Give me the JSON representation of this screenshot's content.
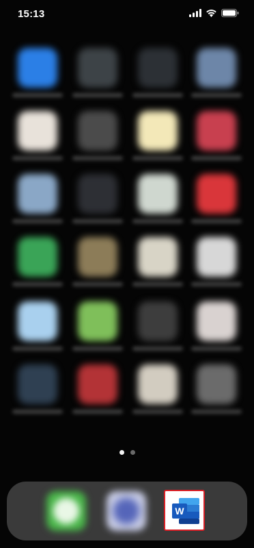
{
  "status_bar": {
    "time": "15:13",
    "signal_icon": "cellular-signal-icon",
    "wifi_icon": "wifi-icon",
    "battery_icon": "battery-icon"
  },
  "home_screen": {
    "apps": [
      {
        "name": "app-store-icon",
        "color": "#2b7fe6"
      },
      {
        "name": "blurred-app-icon",
        "color": "#3d4347"
      },
      {
        "name": "blurred-app-icon",
        "color": "#2c3035"
      },
      {
        "name": "blurred-app-icon",
        "color": "#6d86a8"
      },
      {
        "name": "google-photos-icon",
        "color": "#e8e2da"
      },
      {
        "name": "camera-icon",
        "color": "#4b4b4b"
      },
      {
        "name": "notes-icon",
        "color": "#f3e8b8"
      },
      {
        "name": "blurred-app-icon",
        "color": "#c8404f"
      },
      {
        "name": "blurred-app-icon",
        "color": "#8aa7c6"
      },
      {
        "name": "blurred-app-icon",
        "color": "#2d2f34"
      },
      {
        "name": "google-maps-icon",
        "color": "#cfd7cf"
      },
      {
        "name": "youtube-icon",
        "color": "#d9363a"
      },
      {
        "name": "google-sheets-icon",
        "color": "#3aa457"
      },
      {
        "name": "calculator-icon",
        "color": "#8c7c58"
      },
      {
        "name": "google-drive-icon",
        "color": "#d8d4c6"
      },
      {
        "name": "clock-icon",
        "color": "#d7d7d7"
      },
      {
        "name": "files-icon",
        "color": "#a9d0ee"
      },
      {
        "name": "messages-icon",
        "color": "#7fbf5a"
      },
      {
        "name": "blurred-app-icon",
        "color": "#3d3d3d"
      },
      {
        "name": "gmail-icon",
        "color": "#d9d2d0"
      },
      {
        "name": "wallpaper-icon",
        "color": "#2f4052"
      },
      {
        "name": "blurred-app-icon",
        "color": "#b33336"
      },
      {
        "name": "chrome-icon",
        "color": "#d2ccc0"
      },
      {
        "name": "blurred-app-icon",
        "color": "#6b6b6b"
      }
    ],
    "page_dots": {
      "count": 2,
      "active": 0
    }
  },
  "dock": {
    "apps": [
      {
        "name": "line-app-icon",
        "color": "#49b649"
      },
      {
        "name": "blurred-app-icon",
        "color": "#9aa3c9"
      }
    ],
    "word": {
      "name": "microsoft-word-icon",
      "letter": "W",
      "highlight_color": "#d81f26"
    }
  }
}
